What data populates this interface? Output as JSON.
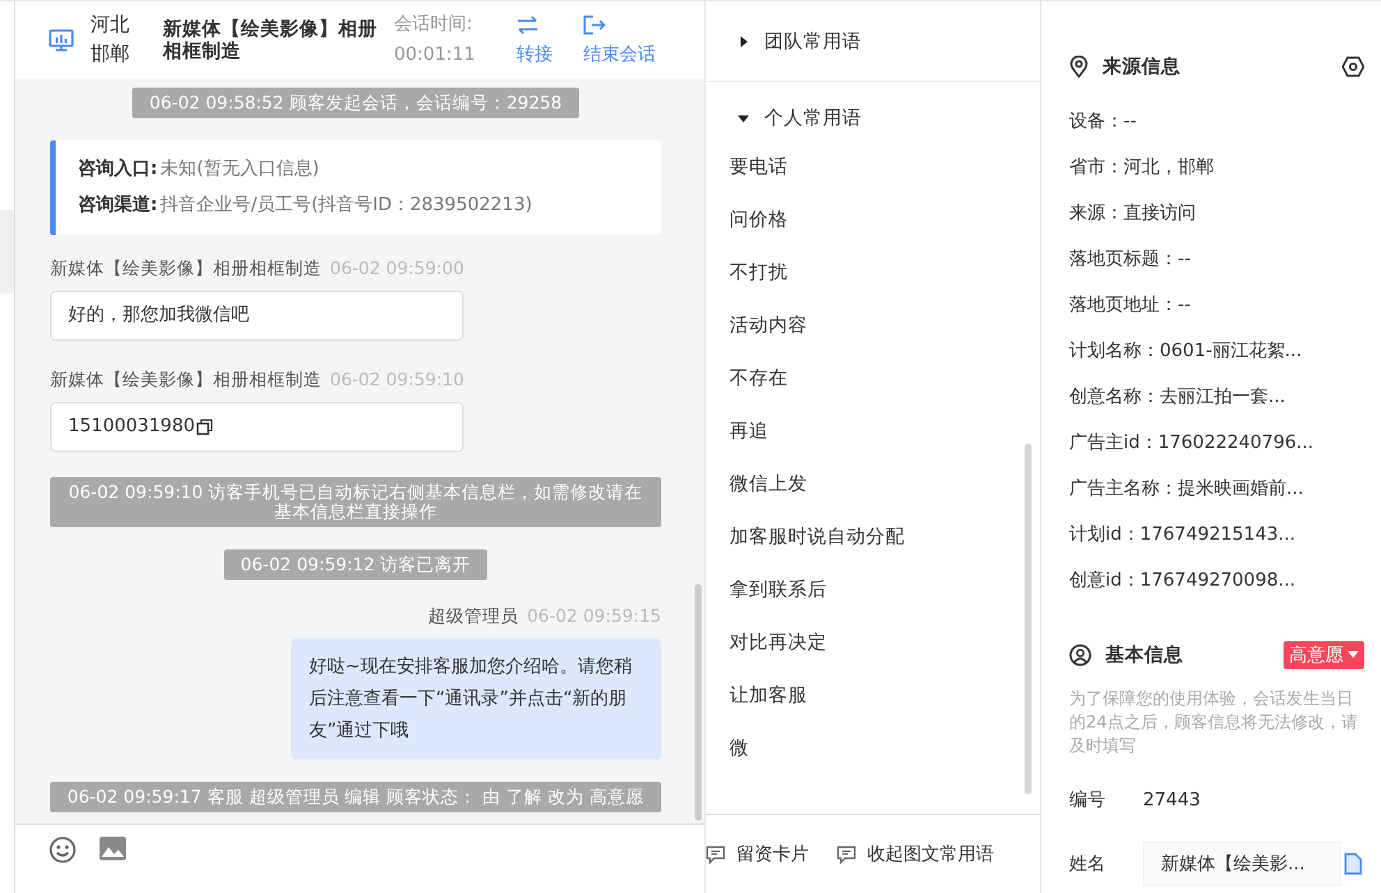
{
  "header": {
    "location": [
      "河北",
      "邯郸"
    ],
    "customer_name": "新媒体【绘美影像】相册相框制造",
    "timer_label": "会话时间:",
    "timer_value": "00:01:11",
    "actions": [
      {
        "kind": "transfer",
        "label": "转接"
      },
      {
        "kind": "end",
        "label": "结束会话"
      }
    ]
  },
  "messages": [
    {
      "kind": "system",
      "text": "06-02 09:58:52 顾客发起会话，会话编号：29258"
    },
    {
      "kind": "entry",
      "rows": [
        {
          "label": "咨询入口:",
          "value": "未知(暂无入口信息)"
        },
        {
          "label": "咨询渠道:",
          "value": "抖音企业号/员工号(抖音号ID：2839502213)"
        }
      ]
    },
    {
      "kind": "incoming",
      "sender": "新媒体【绘美影像】相册相框制造",
      "time": "06-02 09:59:00",
      "text": "好的，那您加我微信吧",
      "copyable": false
    },
    {
      "kind": "incoming",
      "sender": "新媒体【绘美影像】相册相框制造",
      "time": "06-02 09:59:10",
      "text": "15100031980",
      "copyable": true
    },
    {
      "kind": "system",
      "text": "06-02 09:59:10 访客手机号已自动标记右侧基本信息栏，如需修改请在基本信息栏直接操作"
    },
    {
      "kind": "system",
      "text": "06-02 09:59:12 访客已离开"
    },
    {
      "kind": "outgoing",
      "sender": "超级管理员",
      "time": "06-02 09:59:15",
      "text": "好哒~现在安排客服加您介绍哈。请您稍后注意查看一下“通讯录”并点击“新的朋友”通过下哦"
    },
    {
      "kind": "system",
      "text": "06-02 09:59:17 客服 超级管理员 编辑 顾客状态： 由 了解 改为 高意愿"
    }
  ],
  "phrases": {
    "groups": [
      {
        "title": "团队常用语",
        "expanded": false
      },
      {
        "title": "个人常用语",
        "expanded": true,
        "items": [
          "要电话",
          "问价格",
          "不打扰",
          "活动内容",
          "不存在",
          "再追",
          "微信上发",
          "加客服时说自动分配",
          "拿到联系后",
          "对比再决定",
          "让加客服",
          "微"
        ]
      }
    ],
    "bottom_actions": [
      "留资卡片",
      "收起图文常用语"
    ]
  },
  "source_info": {
    "title": "来源信息",
    "fields": [
      "设备：--",
      "省市：河北，邯郸",
      "来源：直接访问",
      "落地页标题：--",
      "落地页地址：--",
      "计划名称：0601-丽江花絮...",
      "创意名称：去丽江拍一套...",
      "广告主id：176022240796...",
      "广告主名称：提米映画婚前...",
      "计划id：176749215143...",
      "创意id：176749270098..."
    ]
  },
  "basic_info": {
    "title": "基本信息",
    "intent_tag": {
      "label": "高意愿",
      "color": "#f5475a"
    },
    "note": "为了保障您的使用体验，会话发生当日的24点之后，顾客信息将无法修改，请及时填写",
    "fields": [
      {
        "kind": "text",
        "label": "编号",
        "value": "27443"
      },
      {
        "kind": "input",
        "label": "姓名",
        "value": "新媒体【绘美影..."
      }
    ]
  }
}
